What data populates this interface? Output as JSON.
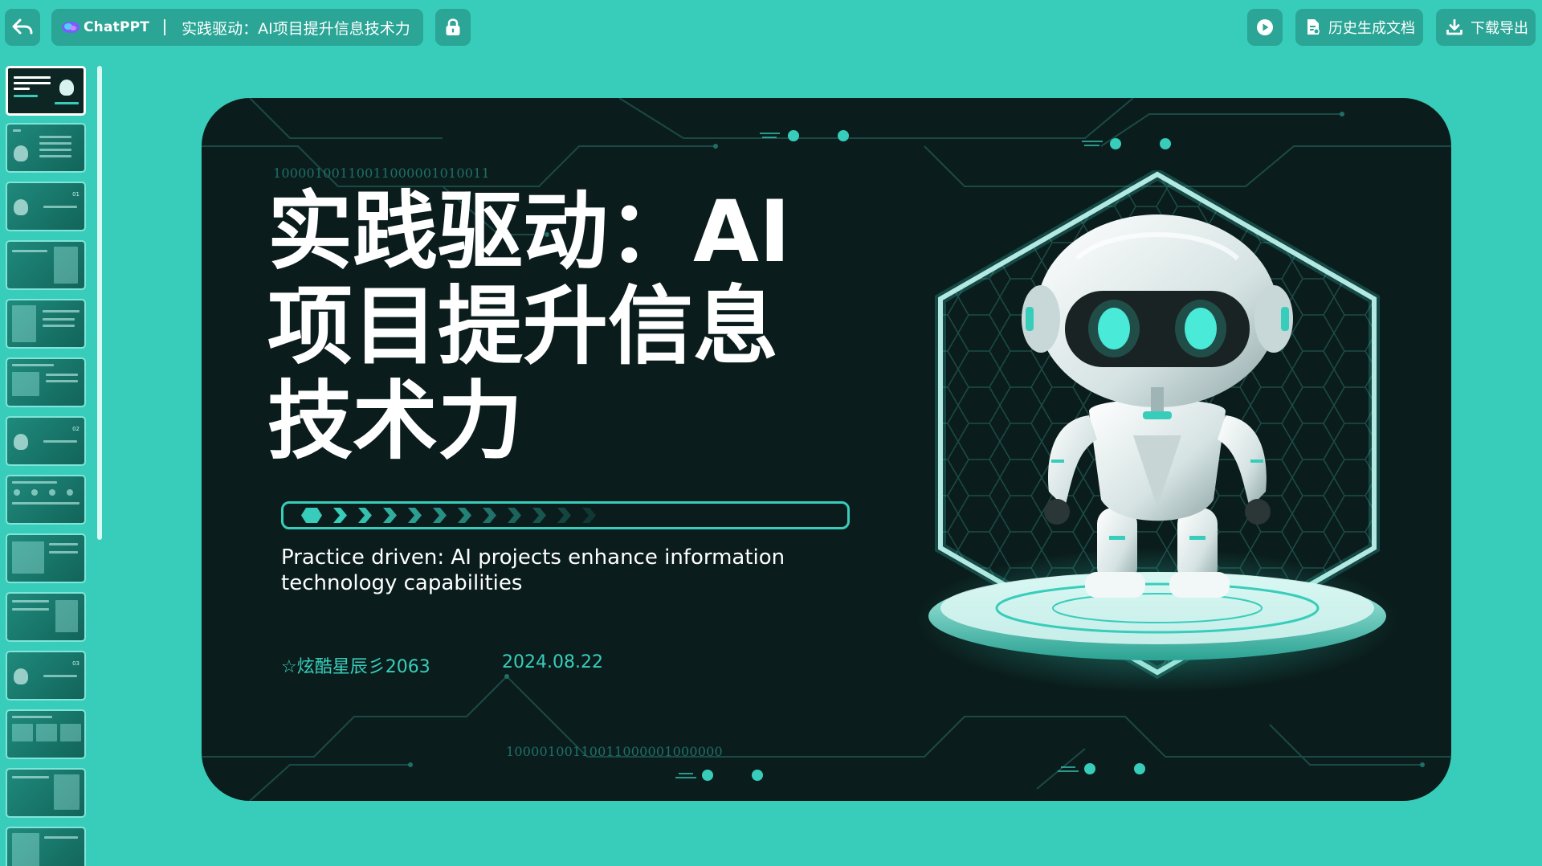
{
  "toolbar": {
    "brand": "ChatPPT",
    "doc_title": "实践驱动：AI项目提升信息技术力",
    "history_label": "历史生成文档",
    "download_label": "下载导出"
  },
  "sidebar": {
    "thumbnails": [
      {
        "slide": 1,
        "active": true
      },
      {
        "slide": 2,
        "active": false
      },
      {
        "slide": 3,
        "active": false
      },
      {
        "slide": 4,
        "active": false
      },
      {
        "slide": 5,
        "active": false
      },
      {
        "slide": 6,
        "active": false
      },
      {
        "slide": 7,
        "active": false
      },
      {
        "slide": 8,
        "active": false
      },
      {
        "slide": 9,
        "active": false
      },
      {
        "slide": 10,
        "active": false
      },
      {
        "slide": 11,
        "active": false
      },
      {
        "slide": 12,
        "active": false
      },
      {
        "slide": 13,
        "active": false
      },
      {
        "slide": 14,
        "active": false
      }
    ]
  },
  "slide": {
    "binary_top": "10000100110011000001010011",
    "binary_bottom": "10000100110011000001000000",
    "title": "实践驱动：AI项目提升信息技术力",
    "subtitle": "Practice driven: AI projects enhance information technology capabilities",
    "author": "☆炫酷星辰彡2063",
    "date": "2024.08.22"
  },
  "colors": {
    "page_background": "#38cdbb",
    "button_background": "#2aa596",
    "slide_background": "#0a1d1c",
    "accent": "#38cdbb"
  },
  "icons": {
    "back": "back-arrow-icon",
    "brand": "chatppt-logo-icon",
    "share": "lock-share-icon",
    "play": "play-icon",
    "history": "document-icon",
    "download": "download-icon"
  }
}
